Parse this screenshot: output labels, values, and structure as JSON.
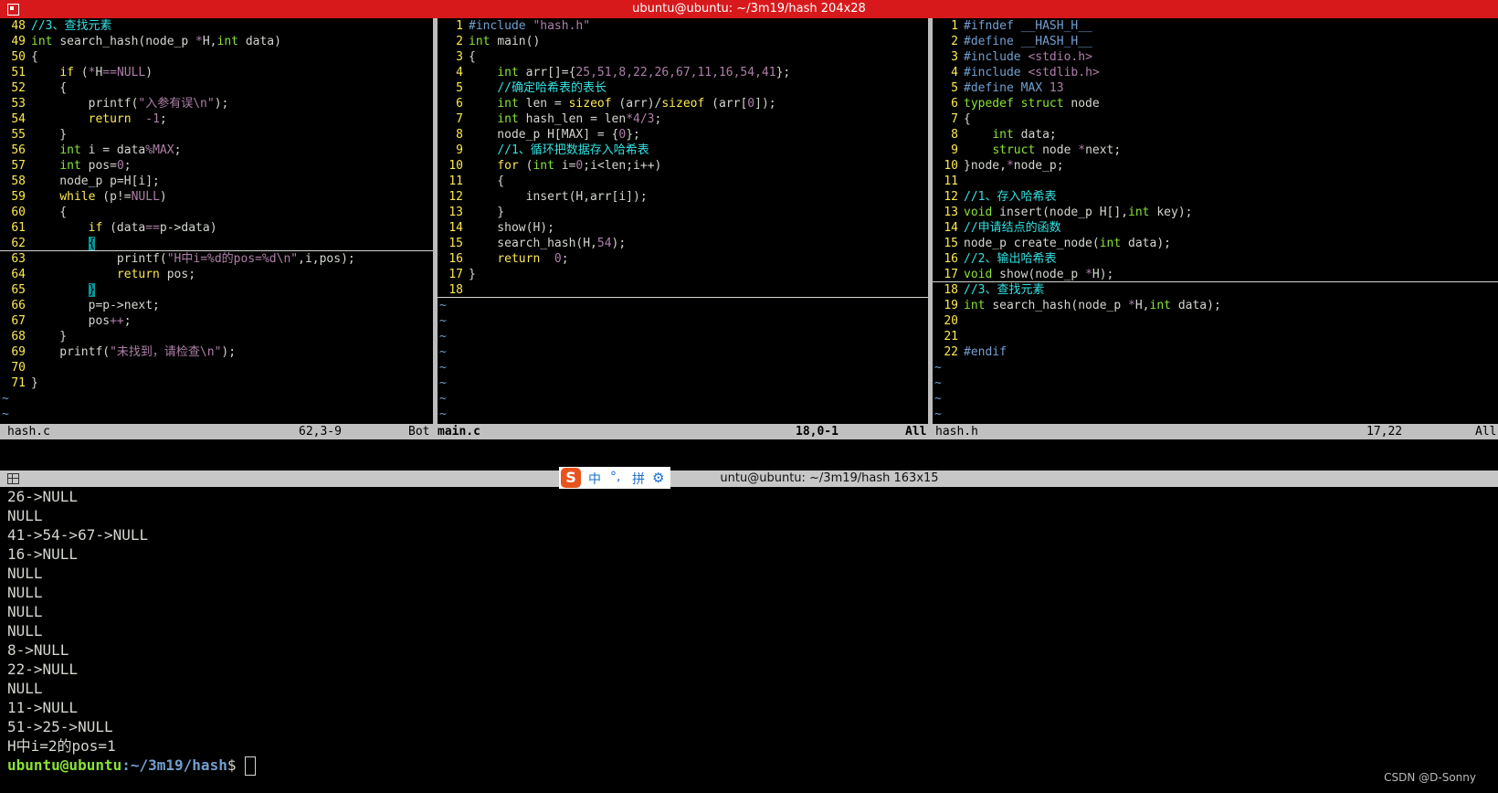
{
  "window_title": "ubuntu@ubuntu: ~/3m19/hash 204x28",
  "panes": [
    {
      "name": "hash-c-pane",
      "lines": [
        {
          "n": "48",
          "tokens": [
            [
              "cm",
              "//3、查找元素"
            ]
          ]
        },
        {
          "n": "49",
          "tokens": [
            [
              "ty",
              "int"
            ],
            [
              "",
              "search_hash(node_p "
            ],
            [
              "num",
              "*"
            ],
            [
              "",
              "H,"
            ],
            [
              "ty",
              "int"
            ],
            [
              "",
              "data)"
            ]
          ]
        },
        {
          "n": "50",
          "tokens": [
            [
              "",
              "{"
            ]
          ]
        },
        {
          "n": "51",
          "tokens": [
            [
              "",
              "    "
            ],
            [
              "kw",
              "if"
            ],
            [
              "",
              "("
            ],
            [
              "num",
              "*"
            ],
            [
              "",
              "H"
            ],
            [
              "num",
              "=="
            ],
            [
              "str",
              "NULL"
            ],
            [
              "",
              ")"
            ]
          ]
        },
        {
          "n": "52",
          "tokens": [
            [
              "",
              "    {"
            ]
          ]
        },
        {
          "n": "53",
          "tokens": [
            [
              "",
              "        printf("
            ],
            [
              "str",
              "\"入参有误\\n\""
            ],
            [
              "",
              ");"
            ]
          ]
        },
        {
          "n": "54",
          "tokens": [
            [
              "",
              "        "
            ],
            [
              "kw",
              "return"
            ],
            [
              "",
              ""
            ],
            [
              "num",
              " -1"
            ],
            [
              "",
              ";"
            ]
          ]
        },
        {
          "n": "55",
          "tokens": [
            [
              "",
              "    }"
            ]
          ]
        },
        {
          "n": "56",
          "tokens": [
            [
              "",
              "    "
            ],
            [
              "ty",
              "int"
            ],
            [
              "",
              "i = data"
            ],
            [
              "num",
              "%"
            ],
            [
              "str",
              "MAX"
            ],
            [
              "",
              ";"
            ]
          ]
        },
        {
          "n": "57",
          "tokens": [
            [
              "",
              "    "
            ],
            [
              "ty",
              "int"
            ],
            [
              "",
              "pos="
            ],
            [
              "num",
              "0"
            ],
            [
              "",
              ";"
            ]
          ]
        },
        {
          "n": "58",
          "tokens": [
            [
              "",
              "    node_p p=H[i];"
            ]
          ]
        },
        {
          "n": "59",
          "tokens": [
            [
              "",
              "    "
            ],
            [
              "kw",
              "while"
            ],
            [
              "",
              "(p!="
            ],
            [
              "str",
              "NULL"
            ],
            [
              "",
              ")"
            ]
          ]
        },
        {
          "n": "60",
          "tokens": [
            [
              "",
              "    {"
            ]
          ]
        },
        {
          "n": "61",
          "tokens": [
            [
              "",
              "        "
            ],
            [
              "kw",
              "if"
            ],
            [
              "",
              "(data"
            ],
            [
              "num",
              "=="
            ],
            [
              "",
              "p->data)"
            ]
          ]
        },
        {
          "n": "62",
          "tokens": [
            [
              "",
              "        "
            ],
            [
              "cur",
              "{"
            ]
          ]
        },
        {
          "n": "63",
          "tokens": [
            [
              "",
              "            printf("
            ],
            [
              "str",
              "\"H中i=%d的pos=%d\\n\""
            ],
            [
              "",
              ",i,pos);"
            ]
          ]
        },
        {
          "n": "64",
          "tokens": [
            [
              "",
              "            "
            ],
            [
              "kw",
              "return"
            ],
            [
              "",
              ""
            ],
            [
              "",
              "pos;"
            ]
          ]
        },
        {
          "n": "65",
          "tokens": [
            [
              "",
              "        "
            ],
            [
              "cur",
              "}"
            ]
          ]
        },
        {
          "n": "66",
          "tokens": [
            [
              "",
              "        p=p->next;"
            ]
          ]
        },
        {
          "n": "67",
          "tokens": [
            [
              "",
              "        pos"
            ],
            [
              "num",
              "++"
            ],
            [
              "",
              ";"
            ]
          ]
        },
        {
          "n": "68",
          "tokens": [
            [
              "",
              "    }"
            ]
          ]
        },
        {
          "n": "69",
          "tokens": [
            [
              "",
              "    printf("
            ],
            [
              "str",
              "\"未找到，请检查\\n\""
            ],
            [
              "",
              ");"
            ]
          ]
        },
        {
          "n": "70",
          "tokens": [
            [
              "",
              ""
            ]
          ]
        },
        {
          "n": "71",
          "tokens": [
            [
              "",
              "}"
            ]
          ]
        }
      ],
      "tildes": 2,
      "status": {
        "file": "hash.c",
        "pos": "62,3-9",
        "pct": "Bot"
      }
    },
    {
      "name": "main-c-pane",
      "lines": [
        {
          "n": "1",
          "tokens": [
            [
              "pp",
              "#include "
            ],
            [
              "str",
              "\"hash.h\""
            ]
          ]
        },
        {
          "n": "2",
          "tokens": [
            [
              "ty",
              "int"
            ],
            [
              "",
              "main()"
            ]
          ]
        },
        {
          "n": "3",
          "tokens": [
            [
              "",
              "{"
            ]
          ]
        },
        {
          "n": "4",
          "tokens": [
            [
              "",
              "    "
            ],
            [
              "ty",
              "int"
            ],
            [
              "",
              "arr[]={"
            ],
            [
              "num",
              "25,51,8,22,26,67,11,16,54,41"
            ],
            [
              "",
              "};"
            ]
          ]
        },
        {
          "n": "5",
          "tokens": [
            [
              "",
              "    "
            ],
            [
              "cm",
              "//确定哈希表的表长"
            ]
          ]
        },
        {
          "n": "6",
          "tokens": [
            [
              "",
              "    "
            ],
            [
              "ty",
              "int"
            ],
            [
              "",
              "len = "
            ],
            [
              "kw",
              "sizeof"
            ],
            [
              "",
              "(arr)/"
            ],
            [
              "kw",
              "sizeof"
            ],
            [
              "",
              "(arr["
            ],
            [
              "num",
              "0"
            ],
            [
              "",
              "]);"
            ]
          ]
        },
        {
          "n": "7",
          "tokens": [
            [
              "",
              "    "
            ],
            [
              "ty",
              "int"
            ],
            [
              "",
              "hash_len = len"
            ],
            [
              "num",
              "*4/3"
            ],
            [
              "",
              ";"
            ]
          ]
        },
        {
          "n": "8",
          "tokens": [
            [
              "",
              "    node_p H[MAX] = {"
            ],
            [
              "num",
              "0"
            ],
            [
              "",
              "};"
            ]
          ]
        },
        {
          "n": "9",
          "tokens": [
            [
              "",
              "    "
            ],
            [
              "cm",
              "//1、循环把数据存入哈希表"
            ]
          ]
        },
        {
          "n": "10",
          "tokens": [
            [
              "",
              "    "
            ],
            [
              "kw",
              "for"
            ],
            [
              "",
              "("
            ],
            [
              "ty",
              "int"
            ],
            [
              "",
              "i="
            ],
            [
              "num",
              "0"
            ],
            [
              "",
              ";i<len;i++)"
            ]
          ]
        },
        {
          "n": "11",
          "tokens": [
            [
              "",
              "    {"
            ]
          ]
        },
        {
          "n": "12",
          "tokens": [
            [
              "",
              "        insert(H,arr[i]);"
            ]
          ]
        },
        {
          "n": "13",
          "tokens": [
            [
              "",
              "    }"
            ]
          ]
        },
        {
          "n": "14",
          "tokens": [
            [
              "",
              "    show(H);"
            ]
          ]
        },
        {
          "n": "15",
          "tokens": [
            [
              "",
              "    search_hash(H,"
            ],
            [
              "num",
              "54"
            ],
            [
              "",
              ");"
            ]
          ]
        },
        {
          "n": "16",
          "tokens": [
            [
              "",
              "    "
            ],
            [
              "kw",
              "return"
            ],
            [
              "",
              ""
            ],
            [
              "num",
              " 0"
            ],
            [
              "",
              ";"
            ]
          ]
        },
        {
          "n": "17",
          "tokens": [
            [
              "",
              "}"
            ]
          ]
        },
        {
          "n": "18",
          "tokens": [
            [
              "",
              ""
            ]
          ]
        }
      ],
      "tildes": 8,
      "status": {
        "file": "main.c",
        "pos": "18,0-1",
        "pct": "All"
      }
    },
    {
      "name": "hash-h-pane",
      "lines": [
        {
          "n": "1",
          "tokens": [
            [
              "pp",
              "#ifndef __HASH_H__"
            ]
          ]
        },
        {
          "n": "2",
          "tokens": [
            [
              "pp",
              "#define __HASH_H__"
            ]
          ]
        },
        {
          "n": "3",
          "tokens": [
            [
              "pp",
              "#include "
            ],
            [
              "str",
              "<stdio.h>"
            ]
          ]
        },
        {
          "n": "4",
          "tokens": [
            [
              "pp",
              "#include "
            ],
            [
              "str",
              "<stdlib.h>"
            ]
          ]
        },
        {
          "n": "5",
          "tokens": [
            [
              "pp",
              "#define MAX "
            ],
            [
              "num",
              "13"
            ]
          ]
        },
        {
          "n": "6",
          "tokens": [
            [
              "ty",
              "typedef struct"
            ],
            [
              "",
              "node"
            ]
          ]
        },
        {
          "n": "7",
          "tokens": [
            [
              "",
              "{"
            ]
          ]
        },
        {
          "n": "8",
          "tokens": [
            [
              "",
              "    "
            ],
            [
              "ty",
              "int"
            ],
            [
              "",
              "data;"
            ]
          ]
        },
        {
          "n": "9",
          "tokens": [
            [
              "",
              "    "
            ],
            [
              "ty",
              "struct"
            ],
            [
              "",
              "node "
            ],
            [
              "num",
              "*"
            ],
            [
              "",
              "next;"
            ]
          ]
        },
        {
          "n": "10",
          "tokens": [
            [
              "",
              "}node,"
            ],
            [
              "num",
              "*"
            ],
            [
              "",
              "node_p;"
            ]
          ]
        },
        {
          "n": "11",
          "tokens": [
            [
              "",
              ""
            ]
          ]
        },
        {
          "n": "12",
          "tokens": [
            [
              "cm",
              "//1、存入哈希表"
            ]
          ]
        },
        {
          "n": "13",
          "tokens": [
            [
              "ty",
              "void"
            ],
            [
              "",
              "insert(node_p H[],"
            ],
            [
              "ty",
              "int"
            ],
            [
              "",
              "key);"
            ]
          ]
        },
        {
          "n": "14",
          "tokens": [
            [
              "cm",
              "//申请结点的函数"
            ]
          ]
        },
        {
          "n": "15",
          "tokens": [
            [
              "",
              "node_p create_node("
            ],
            [
              "ty",
              "int"
            ],
            [
              "",
              "data);"
            ]
          ]
        },
        {
          "n": "16",
          "tokens": [
            [
              "cm",
              "//2、输出哈希表"
            ]
          ]
        },
        {
          "n": "17",
          "tokens": [
            [
              "ty",
              "void"
            ],
            [
              "",
              "show(node_p "
            ],
            [
              "num",
              "*"
            ],
            [
              "",
              "H);"
            ]
          ]
        },
        {
          "n": "18",
          "tokens": [
            [
              "cm",
              "//3、查找元素"
            ]
          ]
        },
        {
          "n": "19",
          "tokens": [
            [
              "ty",
              "int"
            ],
            [
              "",
              "search_hash(node_p "
            ],
            [
              "num",
              "*"
            ],
            [
              "",
              "H,"
            ],
            [
              "ty",
              "int"
            ],
            [
              "",
              "data);"
            ]
          ]
        },
        {
          "n": "20",
          "tokens": [
            [
              "",
              ""
            ]
          ]
        },
        {
          "n": "21",
          "tokens": [
            [
              "",
              ""
            ]
          ]
        },
        {
          "n": "22",
          "tokens": [
            [
              "pp",
              "#endif"
            ]
          ]
        }
      ],
      "tildes": 4,
      "status": {
        "file": "hash.h",
        "pos": "17,22",
        "pct": "All"
      }
    }
  ],
  "terminal": {
    "title": "untu@ubuntu: ~/3m19/hash 163x15",
    "output": [
      "26->NULL",
      "NULL",
      "41->54->67->NULL",
      "16->NULL",
      "NULL",
      "NULL",
      "NULL",
      "NULL",
      "8->NULL",
      "22->NULL",
      "NULL",
      "11->NULL",
      "51->25->NULL",
      "H中i=2的pos=1"
    ],
    "prompt_user": "ubuntu@ubuntu",
    "prompt_path": ":~/3m19/hash",
    "prompt_symbol": "$ "
  },
  "ime": {
    "logo": "S",
    "lang": "中",
    "punct": "°,",
    "mode": "拼",
    "settings_icon": "gear-icon"
  },
  "watermark": "CSDN @D-Sonny"
}
